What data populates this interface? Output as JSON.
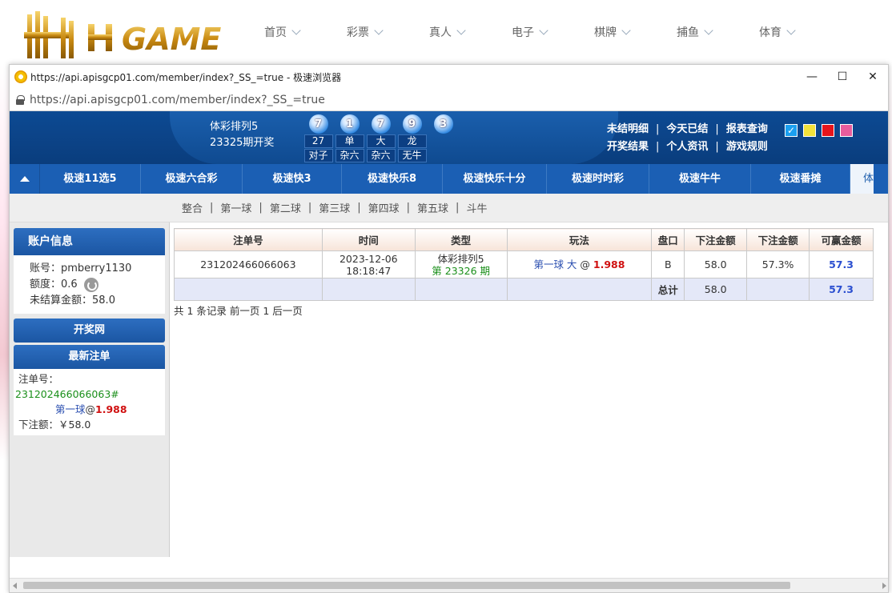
{
  "site": {
    "logo_text": "HH GAME",
    "nav": [
      "首页",
      "彩票",
      "真人",
      "电子",
      "棋牌",
      "捕鱼",
      "体育"
    ]
  },
  "browser": {
    "title": "https://api.apisgcp01.com/member/index?_SS_=true - 极速浏览器",
    "url": "https://api.apisgcp01.com/member/index?_SS_=true",
    "controls": {
      "minimize": "—",
      "maximize": "☐",
      "close": "✕"
    }
  },
  "header": {
    "lottery_name": "体彩排列5",
    "period_text": "23325期开奖",
    "balls": [
      "7",
      "1",
      "7",
      "9",
      "3"
    ],
    "stats_row1": [
      "27",
      "单",
      "大",
      "龙"
    ],
    "stats_row2": [
      "对子",
      "杂六",
      "杂六",
      "无牛"
    ],
    "links_row1": [
      "未结明细",
      "今天已结",
      "报表查询"
    ],
    "links_row2": [
      "开奖结果",
      "个人资讯",
      "游戏规则"
    ],
    "separator": "|",
    "swatch_colors": [
      "#1a9ff0",
      "#f2e23c",
      "#e5141b",
      "#e85c9c"
    ],
    "swatch_check": "✓"
  },
  "main_nav": {
    "tabs": [
      "极速11选5",
      "极速六合彩",
      "极速快3",
      "极速快乐8",
      "极速快乐十分",
      "极速时时彩",
      "极速牛牛",
      "极速番摊",
      "体彩排"
    ]
  },
  "sub_nav": {
    "items": [
      "整合",
      "第一球",
      "第二球",
      "第三球",
      "第四球",
      "第五球",
      "斗牛"
    ],
    "separator": "|"
  },
  "sidebar": {
    "account_title": "账户信息",
    "account_label": "账号：",
    "account_value": "pmberry1130",
    "quota_label": "额度：",
    "quota_value": "0.6",
    "unsettled_label": "未结算金额：",
    "unsettled_value": "58.0",
    "draw_button": "开奖网",
    "recent_title": "最新注单",
    "recent_order_label": "注单号：",
    "recent_order_no": "231202466066063#",
    "recent_play": "第一球",
    "recent_at": "@",
    "recent_odds": "1.988",
    "recent_amount_label": "下注额：",
    "recent_amount": "￥58.0"
  },
  "orders": {
    "headers": [
      "注单号",
      "时间",
      "类型",
      "玩法",
      "盘口",
      "下注金额",
      "下注金额",
      "可赢金额"
    ],
    "rows": [
      {
        "order_no": "231202466066063",
        "date": "2023-12-06",
        "time": "18:18:47",
        "type": "体彩排列5",
        "period": "第 23326 期",
        "play": "第一球 大",
        "at": "@",
        "odds": "1.988",
        "pan": "B",
        "amount": "58.0",
        "rebate": "57.3%",
        "win": "57.3"
      }
    ],
    "total_label": "总计",
    "total_amount": "58.0",
    "total_win": "57.3",
    "pager": "共 1 条记录 前一页 1 后一页"
  }
}
